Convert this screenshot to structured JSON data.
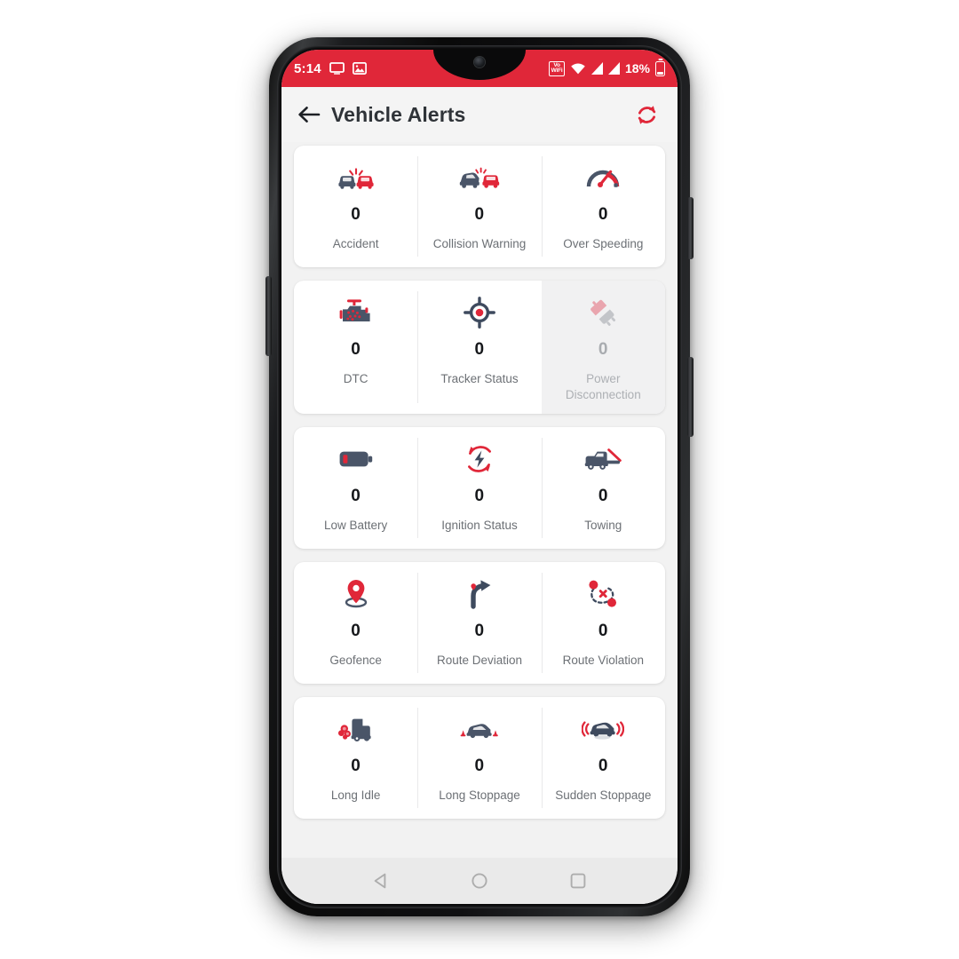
{
  "status_bar": {
    "clock": "5:14",
    "battery_percent": "18%",
    "icons": [
      "cast-screen-icon",
      "image-icon",
      "vowifi-icon",
      "wifi-icon",
      "signal-sim1-icon",
      "signal-sim2-icon",
      "battery-icon"
    ],
    "vowifi_top": "Vo",
    "vowifi_bottom": "WiFi",
    "vowifi_sim": "1",
    "background_color": "#e02739"
  },
  "app_bar": {
    "title": "Vehicle Alerts",
    "back_icon": "arrow-left-icon",
    "refresh_icon": "refresh-icon",
    "accent_color": "#e02739"
  },
  "alerts": {
    "rows": [
      {
        "cells": [
          {
            "label": "Accident",
            "count": "0",
            "icon": "accident-icon",
            "disabled": false
          },
          {
            "label": "Collision Warning",
            "count": "0",
            "icon": "collision-warning-icon",
            "disabled": false
          },
          {
            "label": "Over Speeding",
            "count": "0",
            "icon": "speedometer-icon",
            "disabled": false
          }
        ]
      },
      {
        "cells": [
          {
            "label": "DTC",
            "count": "0",
            "icon": "engine-dtc-icon",
            "disabled": false
          },
          {
            "label": "Tracker Status",
            "count": "0",
            "icon": "tracker-target-icon",
            "disabled": false
          },
          {
            "label": "Power Disconnection",
            "count": "0",
            "icon": "power-plug-disconnect-icon",
            "disabled": true
          }
        ]
      },
      {
        "cells": [
          {
            "label": "Low Battery",
            "count": "0",
            "icon": "low-battery-icon",
            "disabled": false
          },
          {
            "label": "Ignition Status",
            "count": "0",
            "icon": "ignition-bolt-icon",
            "disabled": false
          },
          {
            "label": "Towing",
            "count": "0",
            "icon": "tow-truck-icon",
            "disabled": false
          }
        ]
      },
      {
        "cells": [
          {
            "label": "Geofence",
            "count": "0",
            "icon": "geofence-pin-icon",
            "disabled": false
          },
          {
            "label": "Route Deviation",
            "count": "0",
            "icon": "route-deviation-arrow-icon",
            "disabled": false
          },
          {
            "label": "Route Violation",
            "count": "0",
            "icon": "route-violation-icon",
            "disabled": false
          }
        ]
      },
      {
        "cells": [
          {
            "label": "Long Idle",
            "count": "0",
            "icon": "long-idle-icon",
            "disabled": false
          },
          {
            "label": "Long Stoppage",
            "count": "0",
            "icon": "long-stoppage-icon",
            "disabled": false
          },
          {
            "label": "Sudden Stoppage",
            "count": "0",
            "icon": "sudden-stoppage-icon",
            "disabled": false
          }
        ]
      }
    ]
  },
  "nav_bar": {
    "buttons": [
      {
        "name": "back-nav-button",
        "icon": "triangle-back-icon"
      },
      {
        "name": "home-nav-button",
        "icon": "circle-home-icon"
      },
      {
        "name": "recents-nav-button",
        "icon": "square-recents-icon"
      }
    ]
  },
  "theme": {
    "red": "#e02739",
    "navy": "#3e4a5e",
    "text_dark": "#2f3338",
    "text_muted": "#6c7075",
    "screen_bg": "#f2f2f2",
    "card_bg": "#ffffff",
    "disabled_bg": "#f1f1f2"
  }
}
